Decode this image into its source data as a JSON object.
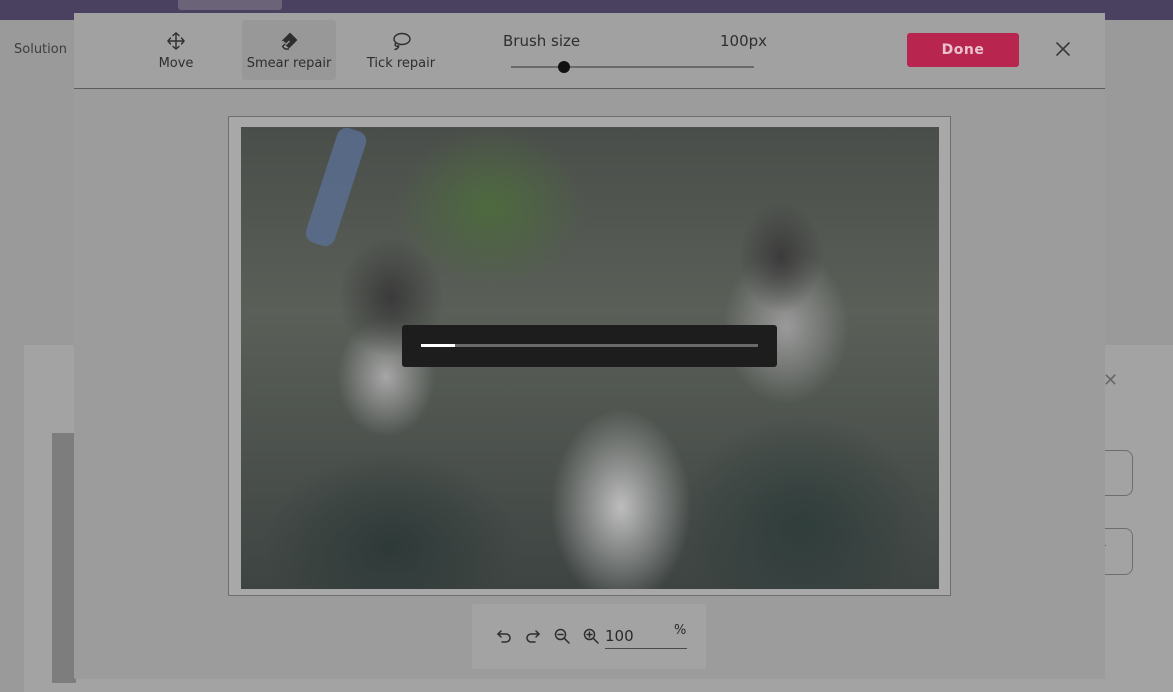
{
  "background": {
    "solution_label": "Solution"
  },
  "toolbar": {
    "tools": [
      {
        "label": "Move"
      },
      {
        "label": "Smear repair"
      },
      {
        "label": "Tick repair"
      }
    ],
    "brush_size_label": "Brush size",
    "brush_size_value": "100px",
    "brush_slider_fraction": 0.22,
    "done_label": "Done"
  },
  "progress": {
    "fraction": 0.1
  },
  "zoom": {
    "value": "100",
    "unit": "%"
  },
  "colors": {
    "accent": "#b8264f",
    "overlay": "#1d1d1d"
  }
}
